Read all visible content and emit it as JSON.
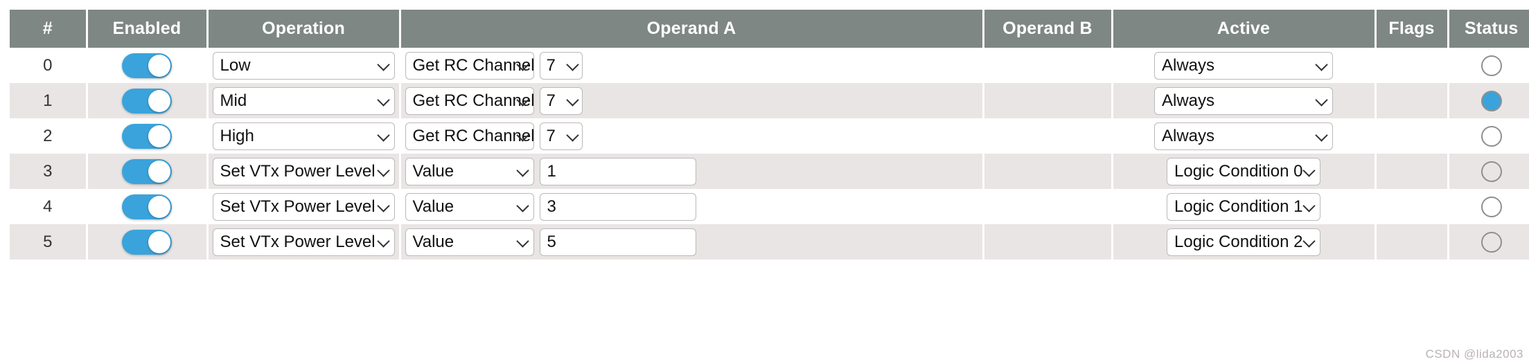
{
  "table": {
    "columns": [
      {
        "key": "index",
        "label": "#"
      },
      {
        "key": "enabled",
        "label": "Enabled"
      },
      {
        "key": "operation",
        "label": "Operation"
      },
      {
        "key": "operandA",
        "label": "Operand A"
      },
      {
        "key": "operandB",
        "label": "Operand B"
      },
      {
        "key": "active",
        "label": "Active"
      },
      {
        "key": "flags",
        "label": "Flags"
      },
      {
        "key": "status",
        "label": "Status"
      }
    ],
    "rows": [
      {
        "index": "0",
        "enabled": "on",
        "operation": "Low",
        "operandA_fn": "Get RC Channel",
        "operandA_value": "7",
        "operandA_kind": "select",
        "operandB": "",
        "active": "Always",
        "active_kind": "always",
        "flags": "",
        "status": "off"
      },
      {
        "index": "1",
        "enabled": "on",
        "operation": "Mid",
        "operandA_fn": "Get RC Channel",
        "operandA_value": "7",
        "operandA_kind": "select",
        "operandB": "",
        "active": "Always",
        "active_kind": "always",
        "flags": "",
        "status": "on"
      },
      {
        "index": "2",
        "enabled": "on",
        "operation": "High",
        "operandA_fn": "Get RC Channel",
        "operandA_value": "7",
        "operandA_kind": "select",
        "operandB": "",
        "active": "Always",
        "active_kind": "always",
        "flags": "",
        "status": "off"
      },
      {
        "index": "3",
        "enabled": "on",
        "operation": "Set VTx Power Level",
        "operandA_fn": "Value",
        "operandA_value": "1",
        "operandA_kind": "text",
        "operandB": "",
        "active": "Logic Condition 0",
        "active_kind": "logic",
        "flags": "",
        "status": "off"
      },
      {
        "index": "4",
        "enabled": "on",
        "operation": "Set VTx Power Level",
        "operandA_fn": "Value",
        "operandA_value": "3",
        "operandA_kind": "text",
        "operandB": "",
        "active": "Logic Condition 1",
        "active_kind": "logic",
        "flags": "",
        "status": "off"
      },
      {
        "index": "5",
        "enabled": "on",
        "operation": "Set VTx Power Level",
        "operandA_fn": "Value",
        "operandA_value": "5",
        "operandA_kind": "text",
        "operandB": "",
        "active": "Logic Condition 2",
        "active_kind": "logic",
        "flags": "",
        "status": "off"
      }
    ]
  },
  "watermark": {
    "text": "CSDN @lida2003"
  },
  "colors": {
    "header_bg": "#7f8784",
    "header_text": "#ffffff",
    "row_odd_bg": "#e9e5e4",
    "row_even_bg": "#ffffff",
    "accent": "#3aa3dc",
    "field_border": "#b9b9b9",
    "status_ring": "#8f8f8f"
  }
}
